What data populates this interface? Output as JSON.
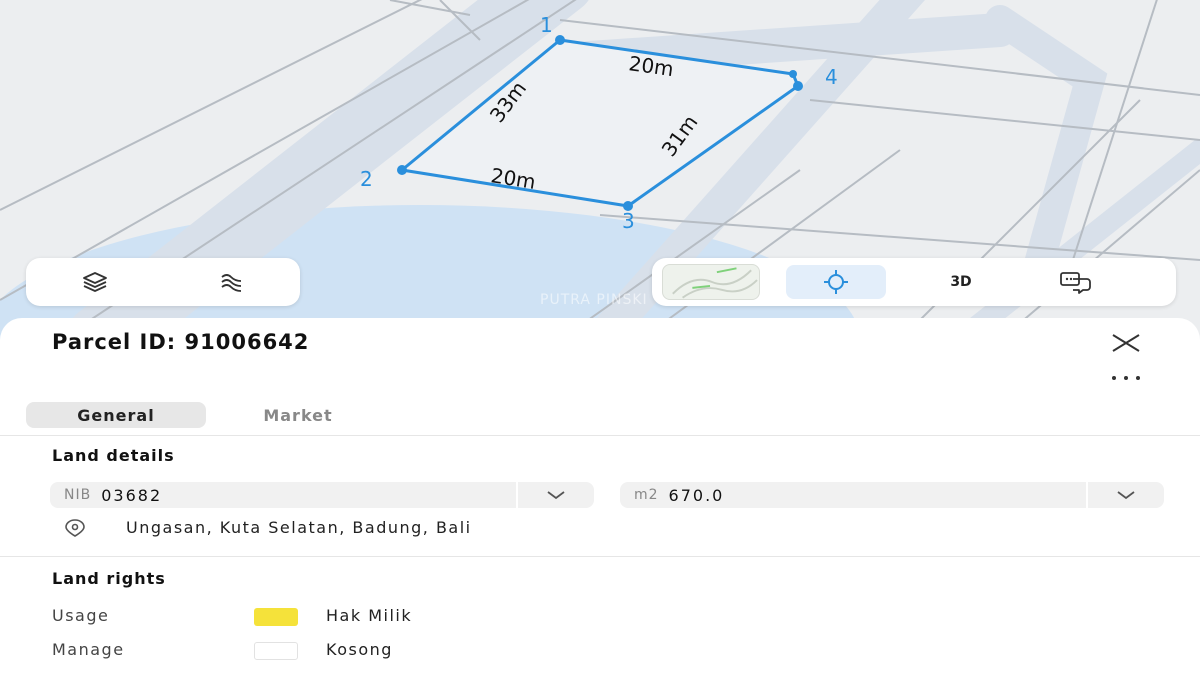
{
  "map": {
    "vertices": [
      "1",
      "2",
      "3",
      "4"
    ],
    "edge_lengths": {
      "e12": "33m",
      "e23": "20m",
      "e34": "31m",
      "e41": "20m"
    },
    "watermark": "PUTRA PINSKI"
  },
  "controls": {
    "left": [
      "layers-icon",
      "contour-icon"
    ],
    "right": [
      "map-thumbnail",
      "crosshair-icon",
      "3d",
      "feedback-icon"
    ],
    "label_3d": "3D"
  },
  "panel": {
    "title": "Parcel ID: 91006642",
    "tabs": [
      {
        "label": "General",
        "active": true
      },
      {
        "label": "Market",
        "active": false
      }
    ],
    "land_details": {
      "title": "Land details",
      "nib": {
        "prefix": "NIB",
        "value": "03682"
      },
      "area": {
        "prefix": "m2",
        "value": "670.0"
      },
      "address": "Ungasan, Kuta Selatan, Badung, Bali"
    },
    "land_rights": {
      "title": "Land rights",
      "rows": [
        {
          "label": "Usage",
          "value": "Hak Milik",
          "color": "#f5e23a"
        },
        {
          "label": "Manage",
          "value": "Kosong",
          "color": "#ffffff"
        }
      ]
    }
  },
  "colors": {
    "accent": "#2a8fdc",
    "road": "#dbe3ec",
    "active_tab": "#e7e7e7"
  }
}
